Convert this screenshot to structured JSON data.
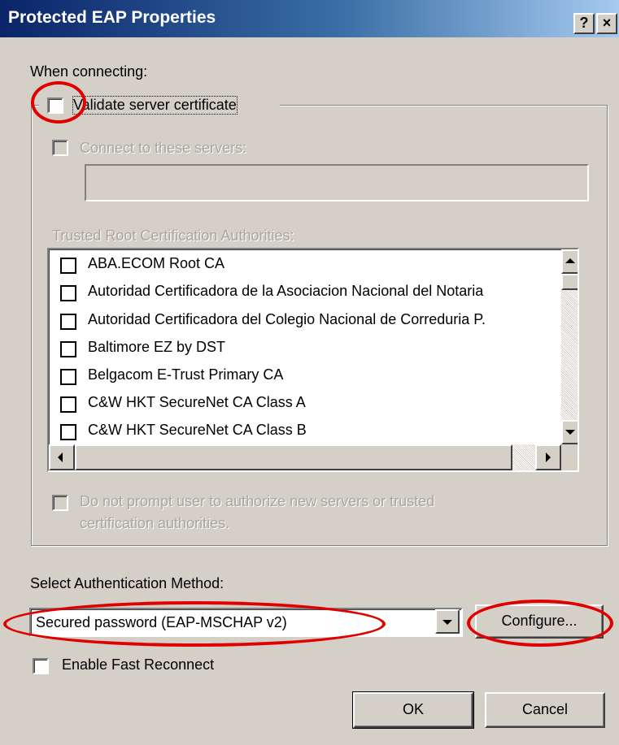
{
  "window": {
    "title": "Protected EAP Properties",
    "help_button": "?",
    "close_button": "×"
  },
  "when_connecting_label": "When connecting:",
  "validate_server_certificate": {
    "label": "Validate server certificate",
    "checked": false
  },
  "connect_to_servers": {
    "label": "Connect to these servers:",
    "checked": false,
    "disabled": true,
    "value": ""
  },
  "trusted_root_label": "Trusted Root Certification Authorities:",
  "certificates": [
    {
      "name": "ABA.ECOM Root CA",
      "checked": false
    },
    {
      "name": "Autoridad Certificadora de la Asociacion Nacional del Notaria",
      "checked": false
    },
    {
      "name": "Autoridad Certificadora del Colegio Nacional de Correduria P.",
      "checked": false
    },
    {
      "name": "Baltimore EZ by DST",
      "checked": false
    },
    {
      "name": "Belgacom E-Trust Primary CA",
      "checked": false
    },
    {
      "name": "C&W HKT SecureNet CA Class A",
      "checked": false
    },
    {
      "name": "C&W HKT SecureNet CA Class B",
      "checked": false
    }
  ],
  "do_not_prompt": {
    "line1": "Do not prompt user to authorize new servers or trusted",
    "line2": "certification authorities.",
    "checked": false,
    "disabled": true
  },
  "auth_method_label": "Select Authentication Method:",
  "auth_method_selected": "Secured password (EAP-MSCHAP v2)",
  "configure_button": "Configure...",
  "enable_fast_reconnect": {
    "label": "Enable Fast Reconnect",
    "checked": false
  },
  "ok_button": "OK",
  "cancel_button": "Cancel",
  "colors": {
    "title_bar_start": "#0a246a",
    "title_bar_end": "#a6caf0",
    "dialog_face": "#d4d0c8",
    "annotation_red": "#e00000"
  }
}
